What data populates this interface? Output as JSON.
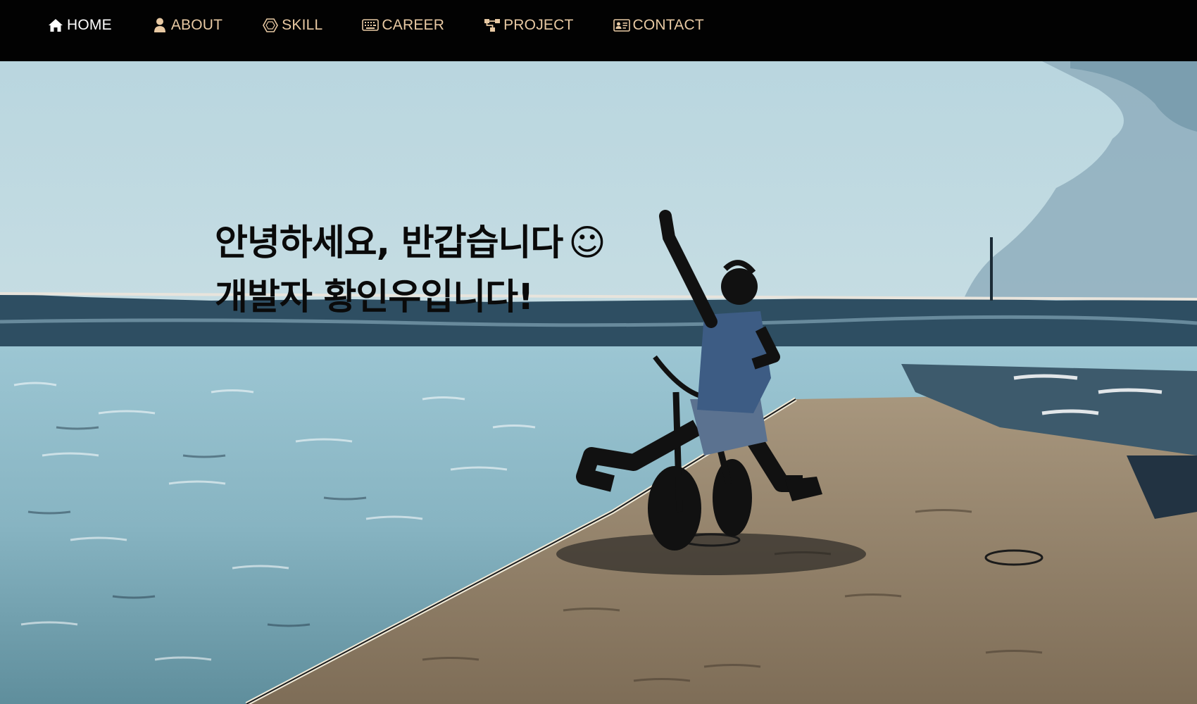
{
  "nav": {
    "items": [
      {
        "label": "HOME",
        "icon": "home-icon",
        "active": true
      },
      {
        "label": "ABOUT",
        "icon": "user-icon",
        "active": false
      },
      {
        "label": "SKILL",
        "icon": "hexagon-icon",
        "active": false
      },
      {
        "label": "CAREER",
        "icon": "keyboard-icon",
        "active": false
      },
      {
        "label": "PROJECT",
        "icon": "sitemap-icon",
        "active": false
      },
      {
        "label": "CONTACT",
        "icon": "id-card-icon",
        "active": false
      }
    ],
    "colors": {
      "active": "#ffffff",
      "inactive": "#e8c9a3",
      "background": "#020202"
    }
  },
  "hero": {
    "line1": "안녕하세요, 반갑습니다",
    "smiley": "☺",
    "line2": "개발자 황인우입니다!",
    "image": "cartoon-filtered photo of a person riding a scooter on a pier by the sea"
  }
}
